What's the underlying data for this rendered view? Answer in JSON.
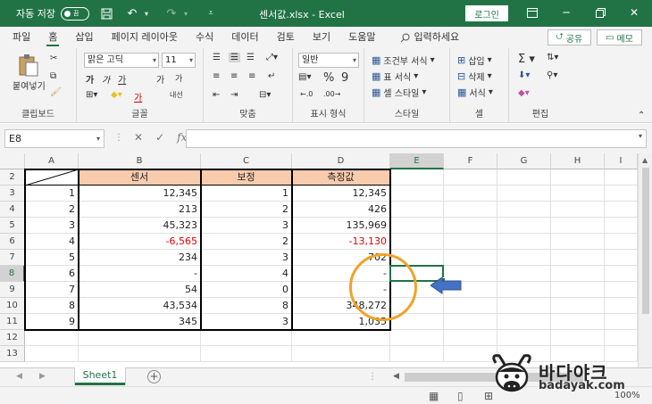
{
  "titlebar": {
    "autosave_label": "자동 저장",
    "autosave_state": "끔",
    "filename": "센서값.xlsx - Excel",
    "login_label": "로그인"
  },
  "menu": {
    "tabs": [
      "파일",
      "홈",
      "삽입",
      "페이지 레이아웃",
      "수식",
      "데이터",
      "검토",
      "보기",
      "도움말"
    ],
    "active_tab": "홈",
    "search_placeholder": "입력하세요",
    "share_label": "공유",
    "memo_label": "메모"
  },
  "ribbon": {
    "clipboard": {
      "paste_label": "붙여넣기",
      "group_label": "클립보드"
    },
    "font": {
      "font_name": "맑은 고딕",
      "font_size": "11",
      "group_label": "글꼴",
      "bold": "가",
      "italic": "가",
      "underline": "가",
      "grow": "가",
      "shrink": "가",
      "phonetic": "내선"
    },
    "alignment": {
      "group_label": "맞춤"
    },
    "number": {
      "format": "일반",
      "group_label": "표시 형식"
    },
    "styles": {
      "conditional": "조건부 서식",
      "table": "표 서식",
      "cell_styles": "셀 스타일",
      "group_label": "스타일"
    },
    "cells": {
      "insert": "삽입",
      "delete": "삭제",
      "format": "서식",
      "group_label": "셀"
    },
    "editing": {
      "group_label": "편집"
    }
  },
  "formula_bar": {
    "name_box": "E8",
    "formula": ""
  },
  "grid": {
    "columns": [
      "A",
      "B",
      "C",
      "D",
      "E",
      "F",
      "G",
      "H",
      "I"
    ],
    "selected_column": "E",
    "rows": [
      "2",
      "3",
      "4",
      "5",
      "6",
      "7",
      "8",
      "9",
      "10",
      "11",
      "12",
      "13"
    ],
    "selected_row": "8",
    "headers": {
      "sensor": "센서",
      "correction": "보정",
      "measured": "측정값"
    },
    "data": [
      {
        "a": "1",
        "b": "12,345",
        "c": "1",
        "d": "12,345",
        "b_neg": false,
        "d_neg": false
      },
      {
        "a": "2",
        "b": "213",
        "c": "2",
        "d": "426",
        "b_neg": false,
        "d_neg": false
      },
      {
        "a": "3",
        "b": "45,323",
        "c": "3",
        "d": "135,969",
        "b_neg": false,
        "d_neg": false
      },
      {
        "a": "4",
        "b": "-6,565",
        "c": "2",
        "d": "-13,130",
        "b_neg": true,
        "d_neg": true
      },
      {
        "a": "5",
        "b": "234",
        "c": "3",
        "d": "702",
        "b_neg": false,
        "d_neg": false
      },
      {
        "a": "6",
        "b": "-",
        "c": "4",
        "d": "-",
        "b_neg": false,
        "d_neg": false
      },
      {
        "a": "7",
        "b": "54",
        "c": "0",
        "d": "-",
        "b_neg": false,
        "d_neg": false
      },
      {
        "a": "8",
        "b": "43,534",
        "c": "8",
        "d": "348,272",
        "b_neg": false,
        "d_neg": false
      },
      {
        "a": "9",
        "b": "345",
        "c": "3",
        "d": "1,035",
        "b_neg": false,
        "d_neg": false
      }
    ]
  },
  "sheets": {
    "tabs": [
      "Sheet1"
    ],
    "active": "Sheet1"
  },
  "statusbar": {
    "zoom": "100%"
  },
  "watermark": {
    "title": "바다야크",
    "url": "badayak.com"
  },
  "colors": {
    "excel_green": "#217346",
    "header_fill": "#f8cbad",
    "negative": "#e00000",
    "annotation": "#f0a22a",
    "arrow": "#4472c4"
  }
}
